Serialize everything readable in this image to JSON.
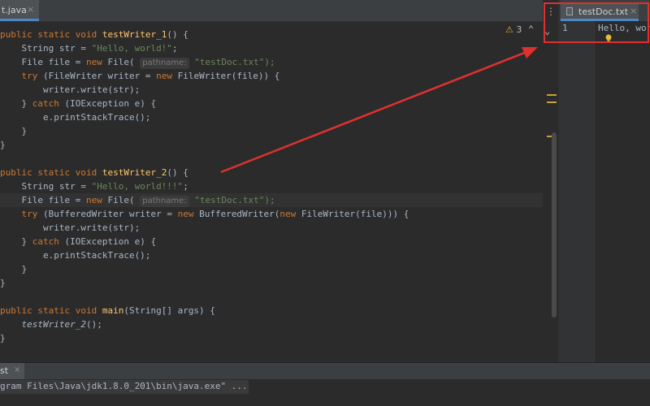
{
  "left_editor": {
    "tab_label": "t.java",
    "tab_close": "×",
    "warning_count": "3",
    "code": [
      "public static void testWriter_1() {",
      "    String str = \"Hello, world!\";",
      "    File file = new File(",
      "    try (FileWriter writer = new FileWriter(file)) {",
      "        writer.write(str);",
      "    } catch (IOException e) {",
      "        e.printStackTrace();",
      "    }",
      "}",
      "",
      "public static void testWriter_2() {",
      "    String str = \"Hello, world!!!\";",
      "    File file = new File(",
      "    try (BufferedWriter writer = new BufferedWriter(new FileWriter(file))) {",
      "        writer.write(str);",
      "    } catch (IOException e) {",
      "        e.printStackTrace();",
      "    }",
      "}",
      "",
      "public static void main(String[] args) {",
      "    testWriter_2();",
      "}"
    ],
    "param_hint": "pathname:",
    "file_arg": "\"testDoc.txt\");"
  },
  "right_editor": {
    "tab_label": "testDoc.txt",
    "tab_close": "×",
    "line_number": "1",
    "content": "Hello, wor"
  },
  "bottom_panel": {
    "tab_label": "st",
    "tab_close": "×",
    "console_line": "gram Files\\Java\\jdk1.8.0_201\\bin\\java.exe\" ..."
  },
  "colors": {
    "annotation_red": "#e03030",
    "accent_blue": "#4a88c7"
  },
  "icons": {
    "warning": "warning-icon",
    "bulb": "lightbulb-icon",
    "file": "text-file-icon"
  }
}
